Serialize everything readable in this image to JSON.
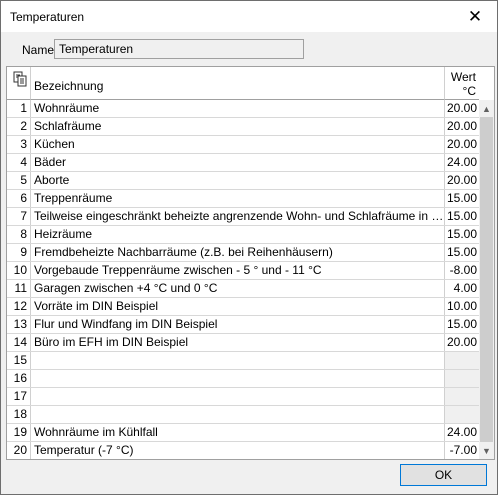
{
  "window": {
    "title": "Temperaturen",
    "close_glyph": "✕"
  },
  "name": {
    "label": "Name",
    "value": "Temperaturen"
  },
  "grid": {
    "header_name": "Bezeichnung",
    "header_value_line1": "Wert",
    "header_value_line2": "°C",
    "rows": [
      {
        "num": "1",
        "name": "Wohnräume",
        "value": "20.00"
      },
      {
        "num": "2",
        "name": "Schlafräume",
        "value": "20.00"
      },
      {
        "num": "3",
        "name": "Küchen",
        "value": "20.00"
      },
      {
        "num": "4",
        "name": "Bäder",
        "value": "24.00"
      },
      {
        "num": "5",
        "name": "Aborte",
        "value": "20.00"
      },
      {
        "num": "6",
        "name": "Treppenräume",
        "value": "15.00"
      },
      {
        "num": "7",
        "name": "Teilweise eingeschränkt beheizte angrenzende Wohn- und Schlafräume in Wohngebäuden",
        "value": "15.00"
      },
      {
        "num": "8",
        "name": "Heizräume",
        "value": "15.00"
      },
      {
        "num": "9",
        "name": "Fremdbeheizte Nachbarräume (z.B. bei Reihenhäusern)",
        "value": "15.00"
      },
      {
        "num": "10",
        "name": "Vorgebaude Treppenräume zwischen - 5 ° und - 11 °C",
        "value": "-8.00"
      },
      {
        "num": "11",
        "name": "Garagen zwischen +4 °C und 0 °C",
        "value": "4.00"
      },
      {
        "num": "12",
        "name": "Vorräte im DIN Beispiel",
        "value": "10.00"
      },
      {
        "num": "13",
        "name": "Flur und Windfang im DIN Beispiel",
        "value": "15.00"
      },
      {
        "num": "14",
        "name": "Büro im EFH im DIN Beispiel",
        "value": "20.00"
      },
      {
        "num": "15",
        "name": "",
        "value": ""
      },
      {
        "num": "16",
        "name": "",
        "value": ""
      },
      {
        "num": "17",
        "name": "",
        "value": ""
      },
      {
        "num": "18",
        "name": "",
        "value": ""
      },
      {
        "num": "19",
        "name": "Wohnräume im Kühlfall",
        "value": "24.00"
      },
      {
        "num": "20",
        "name": "Temperatur (-7 °C)",
        "value": "-7.00"
      }
    ]
  },
  "scrollbar": {
    "up_glyph": "▲",
    "down_glyph": "▼"
  },
  "buttons": {
    "ok": "OK"
  },
  "icons": {
    "copy_icon": "copy-icon",
    "close_icon": "close-icon"
  }
}
